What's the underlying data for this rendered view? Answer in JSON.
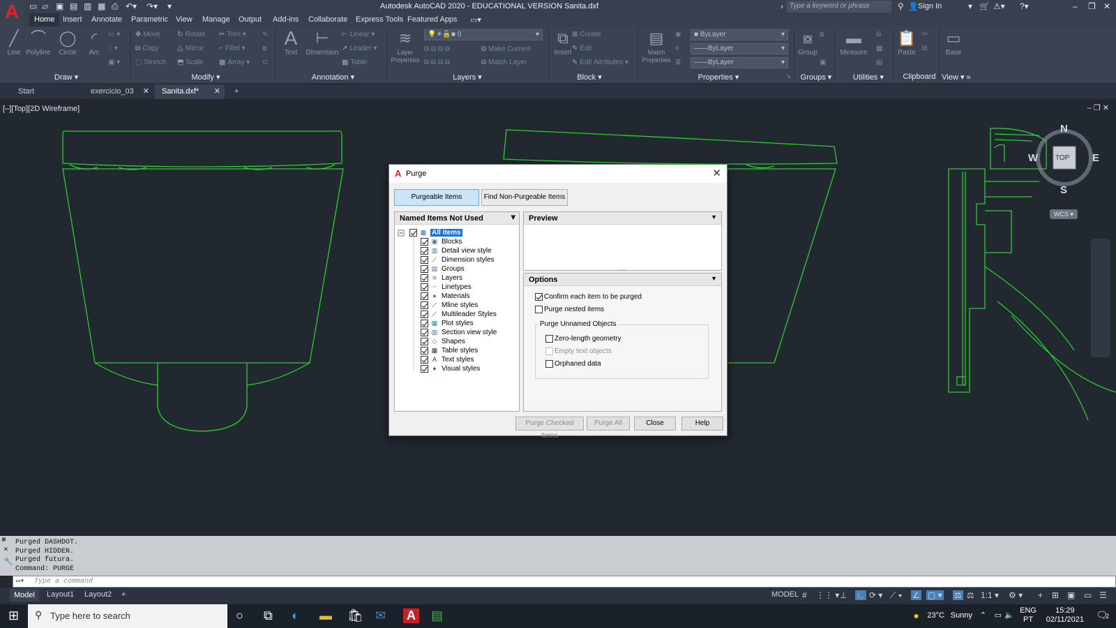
{
  "window": {
    "title": "Autodesk AutoCAD 2020 - EDUCATIONAL VERSION    Sanita.dxf",
    "search_placeholder": "Type a keyword or phrase",
    "sign_in": "Sign In",
    "app_logo": "A"
  },
  "menu_tabs": [
    "Home",
    "Insert",
    "Annotate",
    "Parametric",
    "View",
    "Manage",
    "Output",
    "Add-ins",
    "Collaborate",
    "Express Tools",
    "Featured Apps"
  ],
  "ribbon": {
    "draw": {
      "title": "Draw",
      "line": "Line",
      "polyline": "Polyline",
      "circle": "Circle",
      "arc": "Arc"
    },
    "modify": {
      "title": "Modify",
      "move": "Move",
      "rotate": "Rotate",
      "trim": "Trim",
      "copy": "Copy",
      "mirror": "Mirror",
      "fillet": "Fillet",
      "stretch": "Stretch",
      "scale": "Scale",
      "array": "Array"
    },
    "annotation": {
      "title": "Annotation",
      "text": "Text",
      "dimension": "Dimension",
      "linear": "Linear",
      "leader": "Leader",
      "table": "Table"
    },
    "layers": {
      "title": "Layers",
      "layer_properties": "Layer Properties",
      "layer_value": "0",
      "make_current": "Make Current",
      "match_layer": "Match Layer"
    },
    "block": {
      "title": "Block",
      "insert": "Insert",
      "create": "Create",
      "edit": "Edit",
      "edit_attributes": "Edit Attributes"
    },
    "properties": {
      "title": "Properties",
      "match_properties": "Match Properties",
      "color": "ByLayer",
      "linetype": "ByLayer",
      "lineweight": "ByLayer"
    },
    "groups": {
      "title": "Groups",
      "group": "Group"
    },
    "utilities": {
      "title": "Utilities",
      "measure": "Measure"
    },
    "clipboard": {
      "title": "Clipboard",
      "paste": "Paste"
    },
    "view": {
      "title": "View",
      "base": "Base"
    }
  },
  "file_tabs": [
    {
      "label": "Start"
    },
    {
      "label": "exercicio_03"
    },
    {
      "label": "Sanita.dxf*"
    }
  ],
  "viewport": {
    "label": "[–][Top][2D Wireframe]",
    "viewcube": {
      "n": "N",
      "s": "S",
      "e": "E",
      "w": "W",
      "face": "TOP",
      "wcs": "WCS"
    }
  },
  "dialog": {
    "title": "Purge",
    "tab_purgeable": "Purgeable Items",
    "tab_non_purgeable": "Find Non-Purgeable Items",
    "tree_header": "Named Items Not Used",
    "tree_root": "All items",
    "tree_items": [
      "Blocks",
      "Detail view style",
      "Dimension styles",
      "Groups",
      "Layers",
      "Linetypes",
      "Materials",
      "Mline styles",
      "Multileader Styles",
      "Plot styles",
      "Section view style",
      "Shapes",
      "Table styles",
      "Text styles",
      "Visual styles"
    ],
    "preview_header": "Preview",
    "options_header": "Options",
    "opt_confirm": "Confirm each item to be purged",
    "opt_confirm_checked": true,
    "opt_nested": "Purge nested items",
    "opt_nested_checked": false,
    "unnamed_title": "Purge Unnamed Objects",
    "opt_zero": "Zero-length geometry",
    "opt_empty": "Empty text objects",
    "opt_orphaned": "Orphaned data",
    "btn_purge_checked": "Purge Checked Items",
    "btn_purge_all": "Purge All",
    "btn_close": "Close",
    "btn_help": "Help"
  },
  "command_history": [
    "Purged DASHDOT.",
    "Purged HIDDEN.",
    "Purged futura.",
    "Command: PURGE"
  ],
  "command_placeholder": "Type a command",
  "layout_tabs": [
    "Model",
    "Layout1",
    "Layout2"
  ],
  "status": {
    "model": "MODEL",
    "scale": "1:1"
  },
  "taskbar": {
    "search": "Type here to search",
    "weather_temp": "23°C",
    "weather_text": "Sunny",
    "lang1": "ENG",
    "lang2": "PT",
    "time": "15:29",
    "date": "02/11/2021",
    "notifications": "2"
  },
  "colors": {
    "drawing_lines": "#27d02a",
    "viewport_bg": "#212830",
    "dialog_bg": "#f0f0f0",
    "accent": "#cce4f7"
  }
}
